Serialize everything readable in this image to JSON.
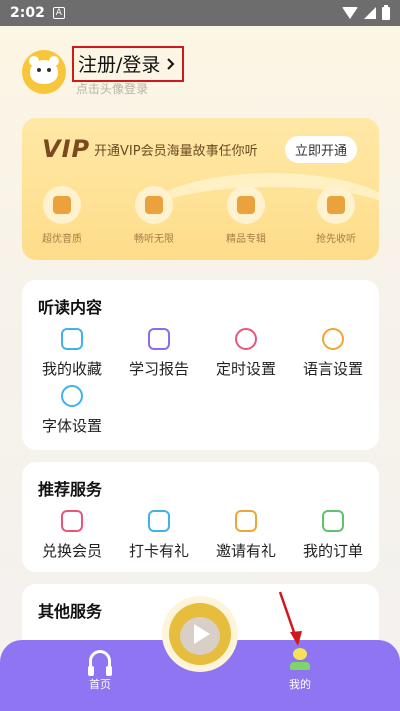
{
  "status_bar": {
    "time": "2:02",
    "notif_icon": "A"
  },
  "header": {
    "login_label": "注册/登录",
    "login_hint": "点击头像登录"
  },
  "vip": {
    "logo": "VIP",
    "slogan": "开通VIP会员海量故事任你听",
    "open_button": "立即开通",
    "features": [
      {
        "label": "超优音质",
        "icon": "headphone-icon"
      },
      {
        "label": "畅听无限",
        "icon": "grid-icon"
      },
      {
        "label": "精品专辑",
        "icon": "album-icon"
      },
      {
        "label": "抢先收听",
        "icon": "tv-icon"
      }
    ]
  },
  "listen_section": {
    "title": "听读内容",
    "items": [
      {
        "label": "我的收藏",
        "color": "#3fb3e8"
      },
      {
        "label": "学习报告",
        "color": "#8a6ee8"
      },
      {
        "label": "定时设置",
        "color": "#e8577a"
      },
      {
        "label": "语言设置",
        "color": "#f0a43a"
      },
      {
        "label": "字体设置",
        "color": "#3fb3e8"
      }
    ]
  },
  "service_section": {
    "title": "推荐服务",
    "items": [
      {
        "label": "兑换会员",
        "color": "#e8577a"
      },
      {
        "label": "打卡有礼",
        "color": "#3fb3e8"
      },
      {
        "label": "邀请有礼",
        "color": "#f0a43a"
      },
      {
        "label": "我的订单",
        "color": "#5cc46b"
      }
    ]
  },
  "other_section": {
    "title": "其他服务"
  },
  "bottom_nav": {
    "home_label": "首页",
    "me_label": "我的"
  }
}
